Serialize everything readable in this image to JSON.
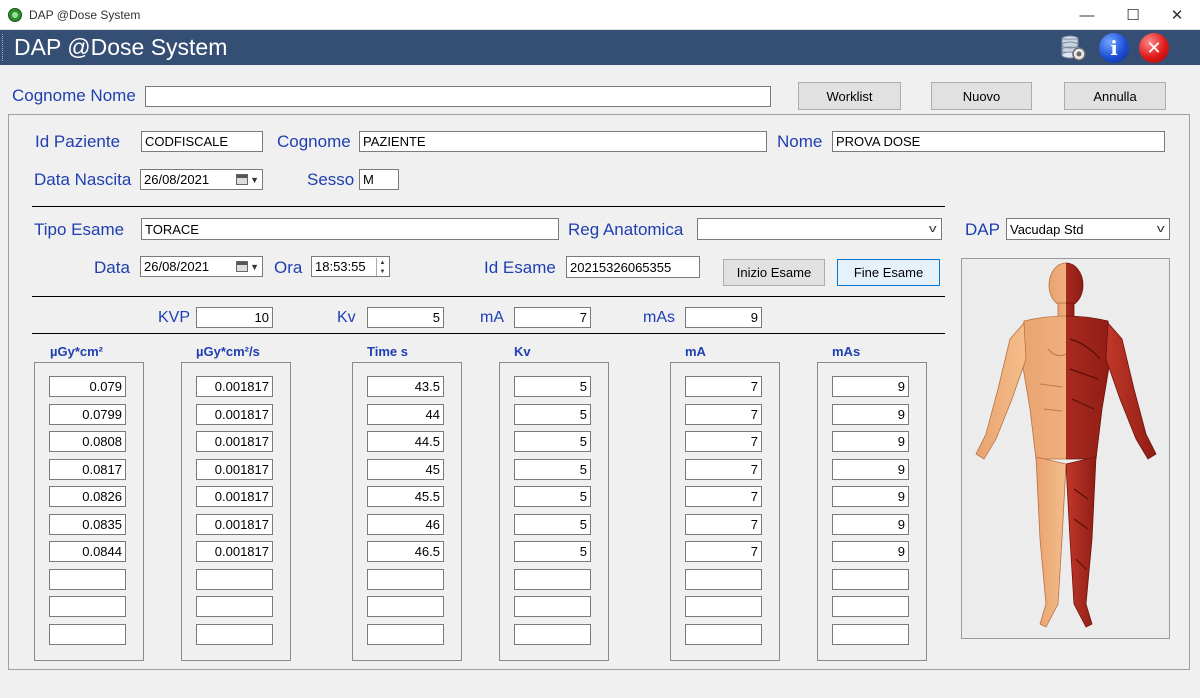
{
  "window": {
    "title": "DAP @Dose System",
    "minimize": "—",
    "maximize": "☐",
    "close": "✕"
  },
  "header": {
    "title": "DAP @Dose System",
    "info_glyph": "i",
    "close_glyph": "✕"
  },
  "search": {
    "label": "Cognome Nome",
    "value": ""
  },
  "buttons": {
    "worklist": "Worklist",
    "nuovo": "Nuovo",
    "annulla": "Annulla",
    "inizio_esame": "Inizio Esame",
    "fine_esame": "Fine Esame"
  },
  "patient": {
    "id_label": "Id Paziente",
    "id_value": "CODFISCALE",
    "cognome_label": "Cognome",
    "cognome_value": "PAZIENTE",
    "nome_label": "Nome",
    "nome_value": "PROVA DOSE",
    "nascita_label": "Data Nascita",
    "nascita_value": "26/08/2021",
    "sesso_label": "Sesso",
    "sesso_value": "M"
  },
  "exam": {
    "tipo_label": "Tipo Esame",
    "tipo_value": "TORACE",
    "reg_label": "Reg Anatomica",
    "reg_value": "",
    "dap_label": "DAP",
    "dap_value": "Vacudap Std",
    "data_label": "Data",
    "data_value": "26/08/2021",
    "ora_label": "Ora",
    "ora_value": "18:53:55",
    "id_label": "Id Esame",
    "id_value": "20215326065355"
  },
  "params": {
    "kvp_label": "KVP",
    "kvp_value": "10",
    "kv_label": "Kv",
    "kv_value": "5",
    "ma_label": "mA",
    "ma_value": "7",
    "mas_label": "mAs",
    "mas_value": "9"
  },
  "table": {
    "headers": [
      "µGy*cm²",
      "µGy*cm²/s",
      "Time s",
      "Kv",
      "mA",
      "mAs"
    ],
    "columns": [
      [
        "0.079",
        "0.0799",
        "0.0808",
        "0.0817",
        "0.0826",
        "0.0835",
        "0.0844",
        "",
        "",
        ""
      ],
      [
        "0.001817",
        "0.001817",
        "0.001817",
        "0.001817",
        "0.001817",
        "0.001817",
        "0.001817",
        "",
        "",
        ""
      ],
      [
        "43.5",
        "44",
        "44.5",
        "45",
        "45.5",
        "46",
        "46.5",
        "",
        "",
        ""
      ],
      [
        "5",
        "5",
        "5",
        "5",
        "5",
        "5",
        "5",
        "",
        "",
        ""
      ],
      [
        "7",
        "7",
        "7",
        "7",
        "7",
        "7",
        "7",
        "",
        "",
        ""
      ],
      [
        "9",
        "9",
        "9",
        "9",
        "9",
        "9",
        "9",
        "",
        "",
        ""
      ]
    ]
  },
  "icons": {
    "app": "app-logo-icon",
    "database": "database-settings-icon",
    "info": "info-icon",
    "close": "close-icon",
    "figure": "anatomy-body-icon"
  }
}
